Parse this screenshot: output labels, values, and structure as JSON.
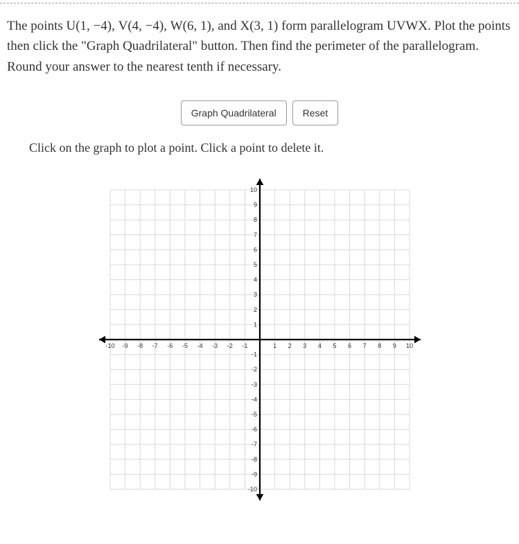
{
  "question": {
    "prefix": "The points ",
    "points": [
      {
        "label": "U",
        "coords": "(1, −4)"
      },
      {
        "label": "V",
        "coords": "(4, −4)"
      },
      {
        "label": "W",
        "coords": "(6, 1)"
      },
      {
        "label": "X",
        "coords": "(3, 1)"
      }
    ],
    "suffix": " form parallelogram UVWX. Plot the points then click the \"Graph Quadrilateral\" button. Then find the perimeter of the parallelogram. Round your answer to the nearest tenth if necessary."
  },
  "buttons": {
    "graph": "Graph Quadrilateral",
    "reset": "Reset"
  },
  "instruction": "Click on the graph to plot a point. Click a point to delete it.",
  "chart_data": {
    "type": "scatter",
    "title": "",
    "xlabel": "",
    "ylabel": "",
    "xlim": [
      -10,
      10
    ],
    "ylim": [
      -10,
      10
    ],
    "xticks": [
      -10,
      -9,
      -8,
      -7,
      -6,
      -5,
      -4,
      -3,
      -2,
      -1,
      1,
      2,
      3,
      4,
      5,
      6,
      7,
      8,
      9,
      10
    ],
    "yticks": [
      -10,
      -9,
      -8,
      -7,
      -6,
      -5,
      -4,
      -3,
      -2,
      -1,
      1,
      2,
      3,
      4,
      5,
      6,
      7,
      8,
      9,
      10
    ],
    "grid": true,
    "series": []
  }
}
